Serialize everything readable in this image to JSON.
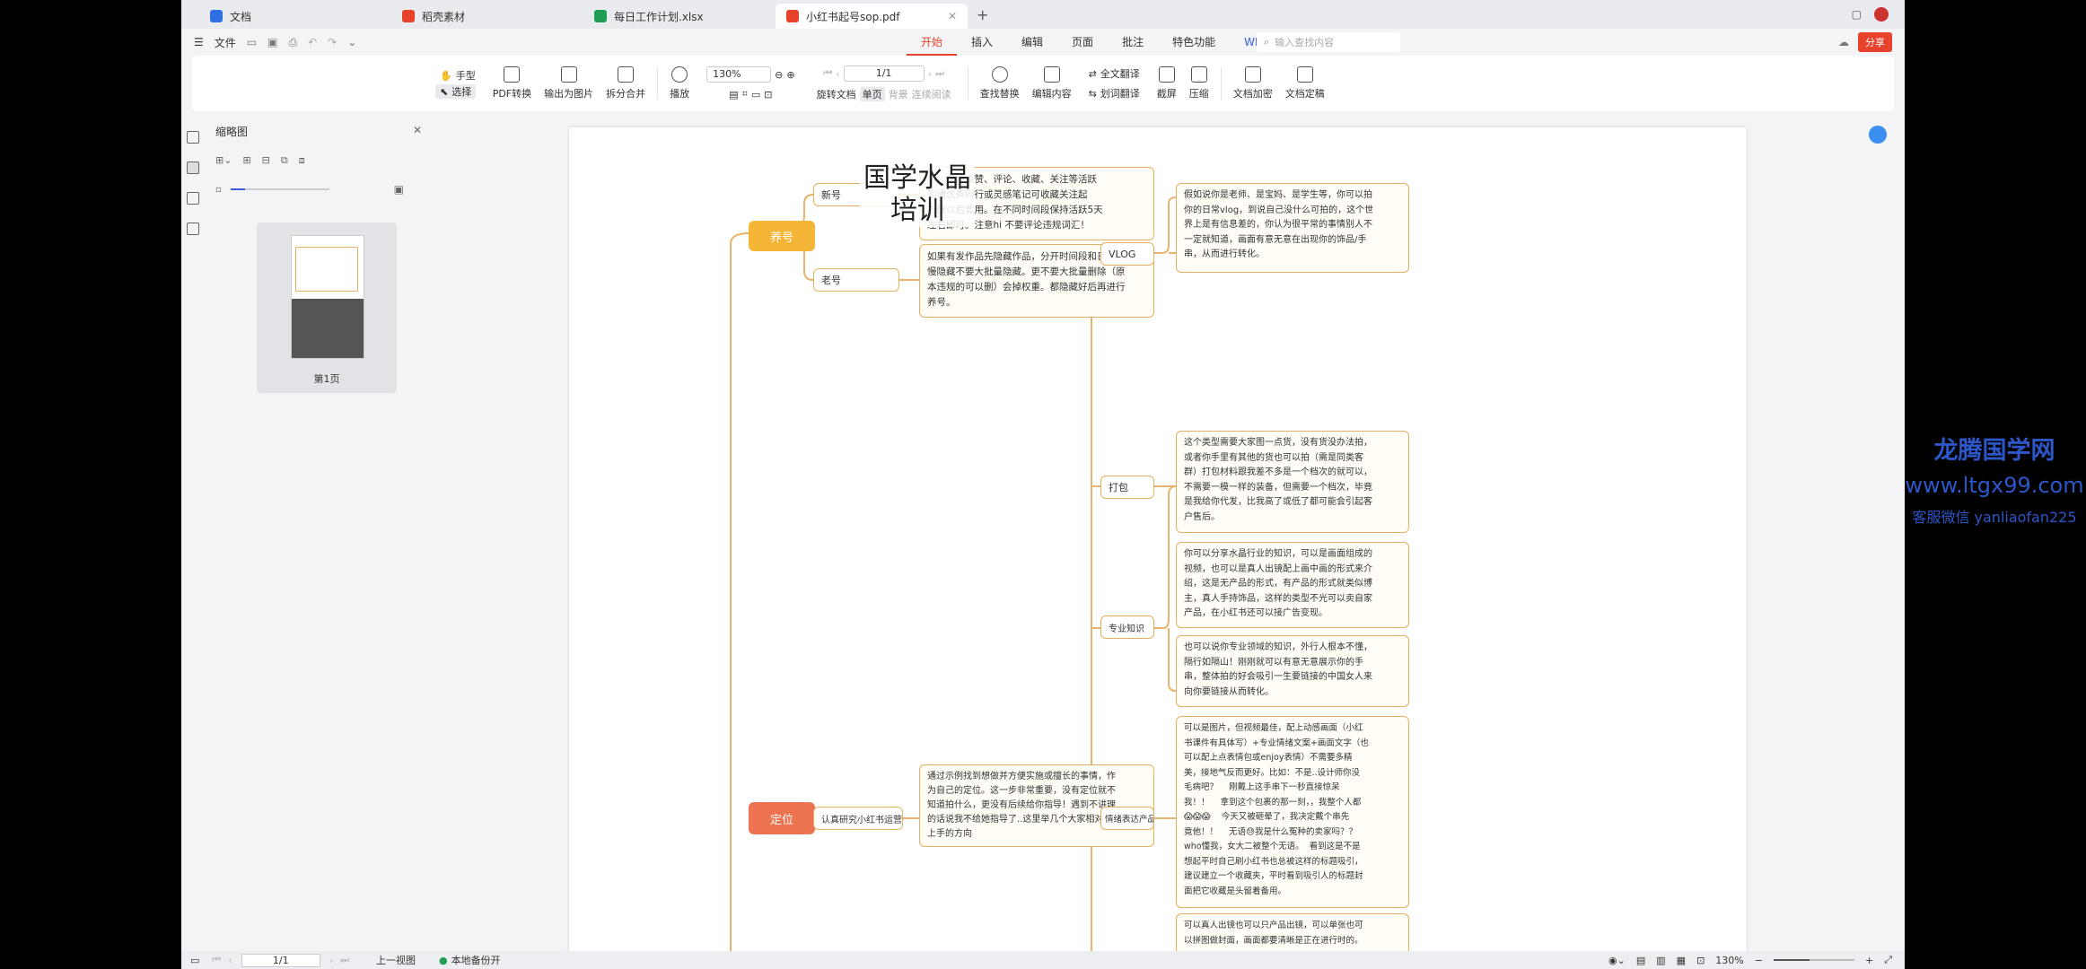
{
  "tabs": [
    {
      "label": "文档",
      "color": "#2f6fe4",
      "active": false
    },
    {
      "label": "稻壳素材",
      "color": "#e8412c",
      "active": false
    },
    {
      "label": "每日工作计划.xlsx",
      "color": "#1f9d55",
      "active": false
    },
    {
      "label": "小红书起号sop.pdf",
      "color": "#e8412c",
      "active": true
    }
  ],
  "menubar": {
    "file": "文件",
    "tabs": [
      "开始",
      "插入",
      "编辑",
      "页面",
      "批注",
      "特色功能"
    ],
    "wps_ai": "WPS AI",
    "search_placeholder": "输入查找内容",
    "share": "分享"
  },
  "toolbar": {
    "hand": "手型",
    "select": "选择",
    "pdf_convert": "PDF转换",
    "export_image": "输出为图片",
    "split_merge": "拆分合并",
    "play": "播放",
    "zoom": "130%",
    "page": "1/1",
    "rotate": "旋转文档",
    "single": "单页",
    "bg": "背景",
    "continuous": "连续阅读",
    "find_replace": "查找替换",
    "edit_content": "编辑内容",
    "full_translate": "全文翻译",
    "word_translate": "划词翻译",
    "screenshot": "截屏",
    "compress": "压缩",
    "encrypt": "文档加密",
    "finalize": "文档定稿"
  },
  "thumb_panel": {
    "title": "缩略图",
    "page_label": "第1页"
  },
  "mindmap": {
    "title_line1": "国学水晶",
    "title_line2": "培训",
    "root1": "养号",
    "root2": "定位",
    "new_acc": "新号",
    "old_acc": "老号",
    "new_acc_text": "页，保持点赞、评论、收藏、关注等活跃\n如通优秀同行或灵感笔记可收藏关注起\n方便以后套用。在不同时间段保持活跃5天\n左右即可。注意hi 不要评论违规词汇！",
    "old_acc_text": "如果有发作品先隐藏作品，分开时间段和日期慢\n慢隐藏不要大批量隐藏。更不要大批量删除（原\n本违规的可以删）会掉权重。都隐藏好后再进行\n养号。",
    "study": "认真研究小红书运营课件",
    "study_text": "通过示例找到想做并方便实施或擅长的事情，作\n为自己的定位。这一步非常重要，没有定位就不\n知道拍什么，更没有后续给你指导！遇到不讲理\n的话说我不给她指导了..这里举几个大家相对好\n上手的方向",
    "vlog": "VLOG",
    "vlog_text": "假如说你是老师、是宝妈、是学生等，你可以拍\n你的日常vlog，到说自己没什么可拍的，这个世\n界上是有信息差的，你认为很平常的事情别人不\n一定就知道，画面有意无意在出现你的饰品/手\n串，从而进行转化。",
    "dabao": "打包",
    "dabao_text": "这个类型需要大家图一点货，没有货没办法拍，\n或者你手里有其他的货也可以拍（需是同类客\n群）打包材料跟我差不多是一个档次的就可以，\n不需要一模一样的装备，但需要一个档次，毕竟\n是我给你代发，比我高了或低了都可能会引起客\n户售后。",
    "zhuanye": "专业知识",
    "zhuanye_text1": "你可以分享水晶行业的知识，可以是画面组成的\n视频，也可以是真人出镜配上画中画的形式来介\n绍，这是无产品的形式，有产品的形式就类似博\n主，真人手持饰品，这样的类型不光可以卖自家\n产品，在小红书还可以接广告变现。",
    "zhuanye_text2": "也可以说你专业领域的知识，外行人根本不懂，\n隔行如隔山！刚刚就可以有意无意展示你的手\n串，整体拍的好会吸引一生要链接的中国女人来\n向你要链接从而转化。",
    "qingxu": "情绪表达产品",
    "qingxu_text": "可以是图片，但视频最佳，配上动感画面（小红\n书课件有具体写）+专业情绪文案+画面文字（也\n可以配上点表情包或enjoy表情）不需要多精\n美，接地气反而更好。比如：不是..设计师你没\n毛病吧？    刚戴上这手串下一秒直接惊呆\n我！！    拿到这个包裹的那一刻，，我整个人都\n😱😱😱    今天又被砸晕了，我决定戴个串先\n竟他！！    无语😓我是什么冤种的卖家吗？？\nwho懂我，女大二被整个无语。  看到这是不是\n想起平时自己刷小红书也总被这样的标题吸引，\n建议建立一个收藏夹，平时看到吸引人的标题封\n面把它收藏是头留着备用。",
    "last_text": "可以真人出镜也可以只产品出镜，可以单张也可\n以拼图做封面，画面都要清晰是正在进行时的。"
  },
  "side_watermark": {
    "line1": "龙腾国学网",
    "line2": "www.ltgx99.com",
    "line3": "客服微信 yanliaofan225"
  },
  "statusbar": {
    "page": "1/1",
    "prev_view": "上一视图",
    "backup": "本地备份开",
    "zoom": "130%"
  }
}
